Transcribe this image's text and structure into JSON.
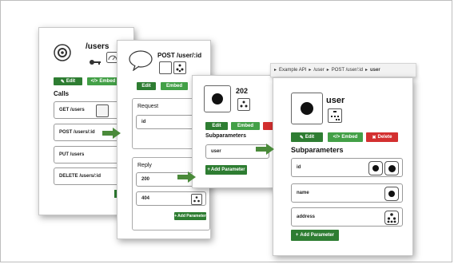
{
  "card_users": {
    "title": "/users",
    "edit": "Edit",
    "embed": "Embed",
    "calls_heading": "Calls",
    "calls": [
      "GET /users",
      "POST /users/:id",
      "PUT /users",
      "DELETE /users/:id"
    ]
  },
  "card_post": {
    "title": "POST /user/:id",
    "edit": "Edit",
    "embed": "Embed",
    "request_heading": "Request",
    "request_field": "id",
    "reply_heading": "Reply",
    "replies": [
      "200",
      "404"
    ],
    "add_parameter": "Add Parameter"
  },
  "card_202": {
    "title": "202",
    "edit": "Edit",
    "embed": "Embed",
    "subparams_heading": "Subparameters",
    "subparam": "user",
    "add_parameter": "Add Parameter"
  },
  "card_user": {
    "breadcrumb": [
      "Example API",
      "/user",
      "POST /user/:id",
      "user"
    ],
    "title": "user",
    "edit": "Edit",
    "embed": "Embed",
    "delete": "Delete",
    "subparams_heading": "Subparameters",
    "params": [
      "id",
      "name",
      "address"
    ],
    "add_parameter": "Add Parameter"
  },
  "colors": {
    "green": "#2e7d32",
    "light_green": "#43a047",
    "red": "#d32f2f"
  }
}
